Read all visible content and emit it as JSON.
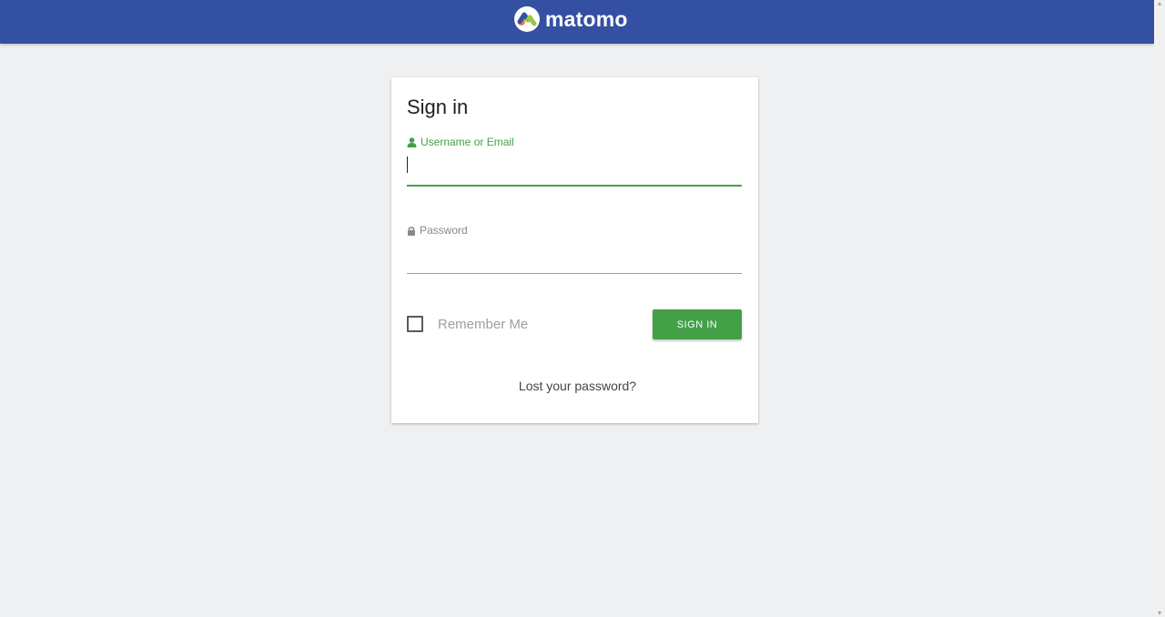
{
  "header": {
    "logo_text": "matomo",
    "background_color": "#3450a3"
  },
  "login": {
    "title": "Sign in",
    "username_label": "Username or Email",
    "username_value": "",
    "password_label": "Password",
    "password_value": "",
    "remember_me_label": "Remember Me",
    "remember_me_checked": false,
    "sign_in_label": "SIGN IN",
    "lost_password_label": "Lost your password?",
    "accent_color": "#43a047"
  },
  "icons": {
    "username": "user-icon",
    "password": "lock-icon",
    "logo": "matomo-logo-icon"
  }
}
